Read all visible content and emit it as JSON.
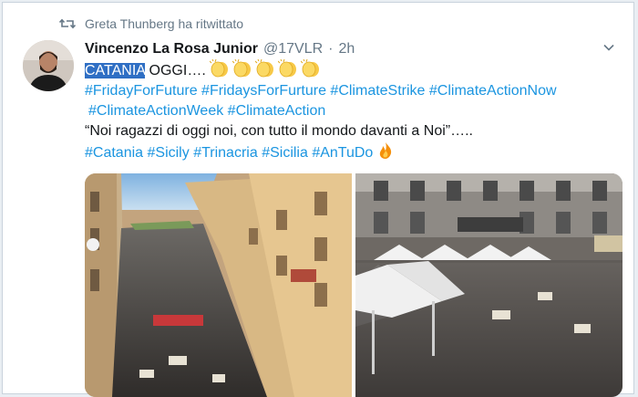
{
  "retweet": {
    "text": "Greta Thunberg ha ritwittato",
    "icon": "retweet-icon"
  },
  "tweet": {
    "display_name": "Vincenzo La Rosa Junior",
    "handle": "@17VLR",
    "separator": "·",
    "time": "2h",
    "line1": {
      "highlighted": "CATANIA",
      "text": " OGGI…. ",
      "emoji": "clapping-hands-icon"
    },
    "line2": [
      "#FridayForFuture",
      "#FridaysForFurture",
      "#ClimateStrike",
      "#ClimateActionNow"
    ],
    "line3": [
      "#ClimateActionWeek",
      "#ClimateAction"
    ],
    "quote": "“Noi ragazzi di oggi noi, con tutto il mondo davanti a Noi”…..",
    "line5": [
      "#Catania",
      "#Sicily",
      "#Trinacria",
      "#Sicilia",
      "#AnTuDo"
    ],
    "line5_emoji": "fire-icon"
  },
  "colors": {
    "hashtag": "#1b95e0",
    "muted": "#657786",
    "selection": "#2f6fc4",
    "text": "#14171a"
  }
}
